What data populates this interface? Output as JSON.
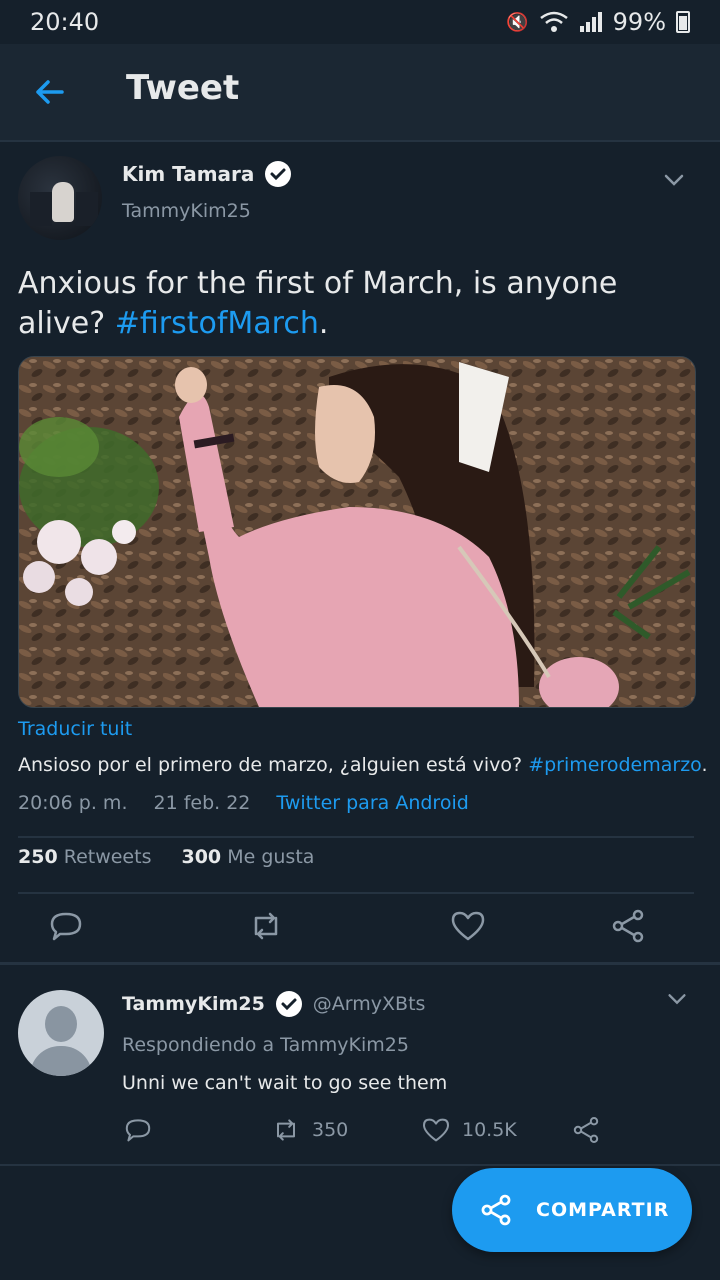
{
  "status_bar": {
    "time": "20:40",
    "battery": "99%"
  },
  "app_bar": {
    "title": "Tweet"
  },
  "tweet": {
    "author_name": "Kim Tamara",
    "author_handle": "TammyKim25",
    "text_main": "Anxious for the first of March, is anyone alive? ",
    "text_hashtag": "#firstofMarch",
    "text_end": ".",
    "translate_link": "Traducir tuit",
    "translation_main": "Ansioso por el primero de marzo, ¿alguien está vivo? ",
    "translation_hashtag": "#primerodemarzo",
    "translation_end": ".",
    "time": "20:06 p. m.",
    "date": "21 feb. 22",
    "source": "Twitter para Android",
    "retweets_count": "250",
    "retweets_label": "Retweets",
    "likes_count": "300",
    "likes_label": "Me gusta"
  },
  "reply": {
    "author_name": "TammyKim25",
    "author_handle": "@ArmyXBts",
    "replying_to": "Respondiendo a TammyKim25",
    "text": "Unni we can't wait to go see them",
    "retweets": "350",
    "likes": "10.5K"
  },
  "fab": {
    "label": "COMPARTIR"
  },
  "colors": {
    "background": "#15202b",
    "accent": "#1d9bf0",
    "muted": "#8b98a5"
  }
}
